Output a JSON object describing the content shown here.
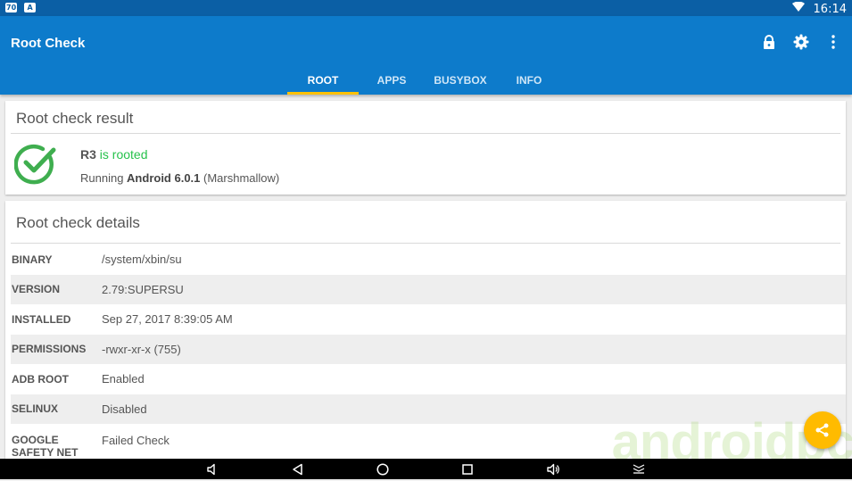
{
  "status_bar": {
    "left_badges": [
      "70",
      "A"
    ],
    "time": "16:14"
  },
  "app": {
    "title": "Root Check",
    "actions": [
      "lock-icon",
      "settings-icon",
      "more-vert-icon"
    ],
    "tabs": [
      {
        "label": "ROOT",
        "active": true
      },
      {
        "label": "APPS",
        "active": false
      },
      {
        "label": "BUSYBOX",
        "active": false
      },
      {
        "label": "INFO",
        "active": false
      }
    ]
  },
  "result_card": {
    "title": "Root check result",
    "device": "R3",
    "status": "is rooted",
    "running_prefix": "Running ",
    "android_version": "Android 6.0.1",
    "version_suffix": " (Marshmallow)"
  },
  "details_card": {
    "title": "Root check details",
    "rows": [
      {
        "key": "BINARY",
        "value": "/system/xbin/su"
      },
      {
        "key": "VERSION",
        "value": "2.79:SUPERSU"
      },
      {
        "key": "INSTALLED",
        "value": "Sep 27, 2017 8:39:05 AM"
      },
      {
        "key": "PERMISSIONS",
        "value": "-rwxr-xr-x (755)"
      },
      {
        "key": "ADB ROOT",
        "value": "Enabled"
      },
      {
        "key": "SELINUX",
        "value": "Disabled"
      },
      {
        "key": "GOOGLE SAFETY NET",
        "value": "Failed Check"
      }
    ]
  },
  "watermark": "androidpc",
  "fab": {
    "icon": "share-icon"
  },
  "nav_bar": [
    "volume-down-icon",
    "back-icon",
    "home-icon",
    "recents-icon",
    "volume-up-icon",
    "expand-icon"
  ],
  "colors": {
    "app_bar": "#0d7bcb",
    "status_bar": "#0b5fa5",
    "tab_indicator": "#ffc107",
    "rooted_green": "#27c24c",
    "fab": "#ffbb00"
  }
}
